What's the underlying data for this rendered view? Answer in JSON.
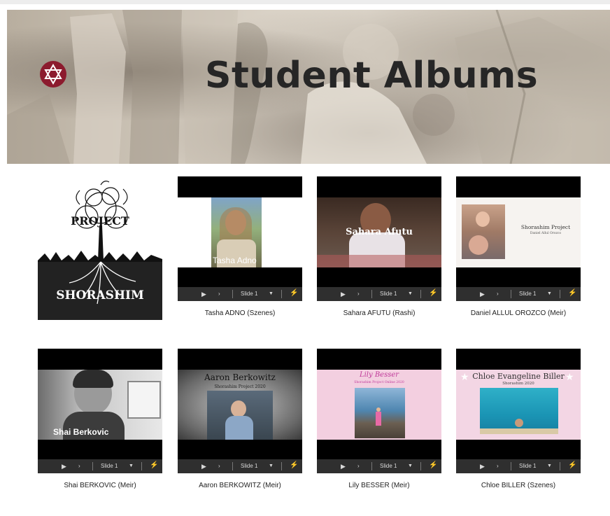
{
  "page": {
    "title": "Student Albums"
  },
  "logo": {
    "line1": "PROJECT",
    "line2": "SHORASHIM"
  },
  "controls": {
    "slide_label": "Slide 1"
  },
  "albums": [
    {
      "caption": "Tasha ADNO (Szenes)",
      "overlay": "Tasha Adno"
    },
    {
      "caption": "Sahara AFUTU (Rashi)",
      "overlay": "Sahara Afutu"
    },
    {
      "caption": "Daniel ALLUL OROZCO (Meir)",
      "overlay": "Shorashim Project",
      "sub": "Daniel Allul Orozco"
    },
    {
      "caption": "Shai BERKOVIC (Meir)",
      "overlay": "Shai Berkovic"
    },
    {
      "caption": "Aaron BERKOWITZ (Meir)",
      "overlay": "Aaron Berkowitz",
      "sub": "Shorashim Project 2020"
    },
    {
      "caption": "Lily BESSER (Meir)",
      "overlay": "Lily Besser",
      "sub": "Shorashim Project Online 2020"
    },
    {
      "caption": "Chloe BILLER (Szenes)",
      "overlay": "Chloe Evangeline Biller",
      "sub": "Shorashim 2020"
    }
  ],
  "colors": {
    "badge": "#8c1b2e",
    "controls_bg": "#2f2f2f",
    "pink_slide": "#f3cfe0"
  }
}
